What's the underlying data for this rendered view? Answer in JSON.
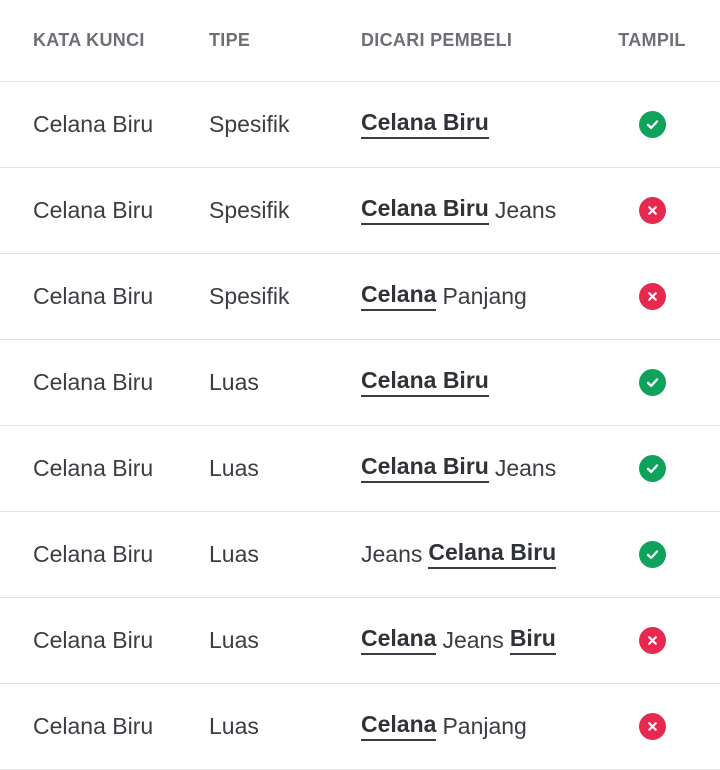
{
  "colors": {
    "ok": "#0ea25a",
    "fail": "#e5294f",
    "header_text": "#6c7075",
    "body_text": "#3a3d42",
    "divider": "#e3e4e6"
  },
  "header": {
    "keyword": "KATA KUNCI",
    "type": "TIPE",
    "search": "DICARI PEMBELI",
    "show": "TAMPIL"
  },
  "rows": [
    {
      "keyword": "Celana Biru",
      "type": "Spesifik",
      "search": [
        {
          "t": "Celana Biru",
          "hl": true
        }
      ],
      "show": "check-icon"
    },
    {
      "keyword": "Celana Biru",
      "type": "Spesifik",
      "search": [
        {
          "t": "Celana Biru",
          "hl": true
        },
        {
          "t": "Jeans",
          "hl": false
        }
      ],
      "show": "cross-icon"
    },
    {
      "keyword": "Celana Biru",
      "type": "Spesifik",
      "search": [
        {
          "t": "Celana",
          "hl": true
        },
        {
          "t": "Panjang",
          "hl": false
        }
      ],
      "show": "cross-icon"
    },
    {
      "keyword": "Celana Biru",
      "type": "Luas",
      "search": [
        {
          "t": "Celana Biru",
          "hl": true
        }
      ],
      "show": "check-icon"
    },
    {
      "keyword": "Celana Biru",
      "type": "Luas",
      "search": [
        {
          "t": "Celana Biru",
          "hl": true
        },
        {
          "t": "Jeans",
          "hl": false
        }
      ],
      "show": "check-icon"
    },
    {
      "keyword": "Celana Biru",
      "type": "Luas",
      "search": [
        {
          "t": "Jeans",
          "hl": false
        },
        {
          "t": "Celana Biru",
          "hl": true
        }
      ],
      "show": "check-icon"
    },
    {
      "keyword": "Celana Biru",
      "type": "Luas",
      "search": [
        {
          "t": "Celana",
          "hl": true
        },
        {
          "t": "Jeans",
          "hl": false
        },
        {
          "t": "Biru",
          "hl": true
        }
      ],
      "show": "cross-icon"
    },
    {
      "keyword": "Celana Biru",
      "type": "Luas",
      "search": [
        {
          "t": "Celana",
          "hl": true
        },
        {
          "t": "Panjang",
          "hl": false
        }
      ],
      "show": "cross-icon"
    }
  ]
}
